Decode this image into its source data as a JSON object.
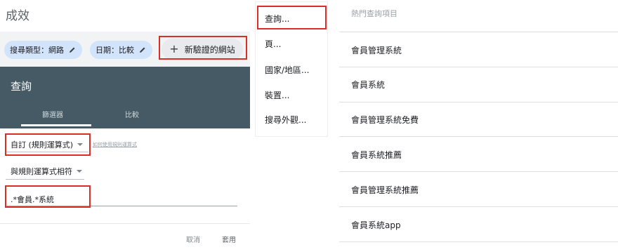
{
  "page": {
    "title": "成效"
  },
  "filters": {
    "search_type": "搜尋類型：網路",
    "date": "日期：比較",
    "add_filter": "新驗證的網站"
  },
  "query_panel": {
    "title": "查詢",
    "tabs": [
      "篩選器",
      "比較"
    ],
    "match_type": "自訂 (規則運算式)",
    "help_link": "如何使用規則運算式",
    "match_condition": "與規則運算式相符",
    "regex_value": ".*會員.*系統",
    "cancel_label": "取消",
    "apply_label": "套用"
  },
  "dimension_menu": {
    "items": [
      "查詢...",
      "頁...",
      "國家/地區...",
      "裝置...",
      "搜尋外觀..."
    ]
  },
  "popular_queries": {
    "header": "熱門查詢項目",
    "items": [
      "會員管理系統",
      "會員系統",
      "會員管理系統免費",
      "會員系統推薦",
      "會員管理系統推薦",
      "會員系統app"
    ]
  },
  "icons": {
    "edit": "pencil-icon",
    "add": "plus-icon",
    "dropdown": "caret-down-icon"
  },
  "colors": {
    "accent": "#455a64",
    "chip": "#d2e3fc",
    "highlight": "#d93025"
  }
}
